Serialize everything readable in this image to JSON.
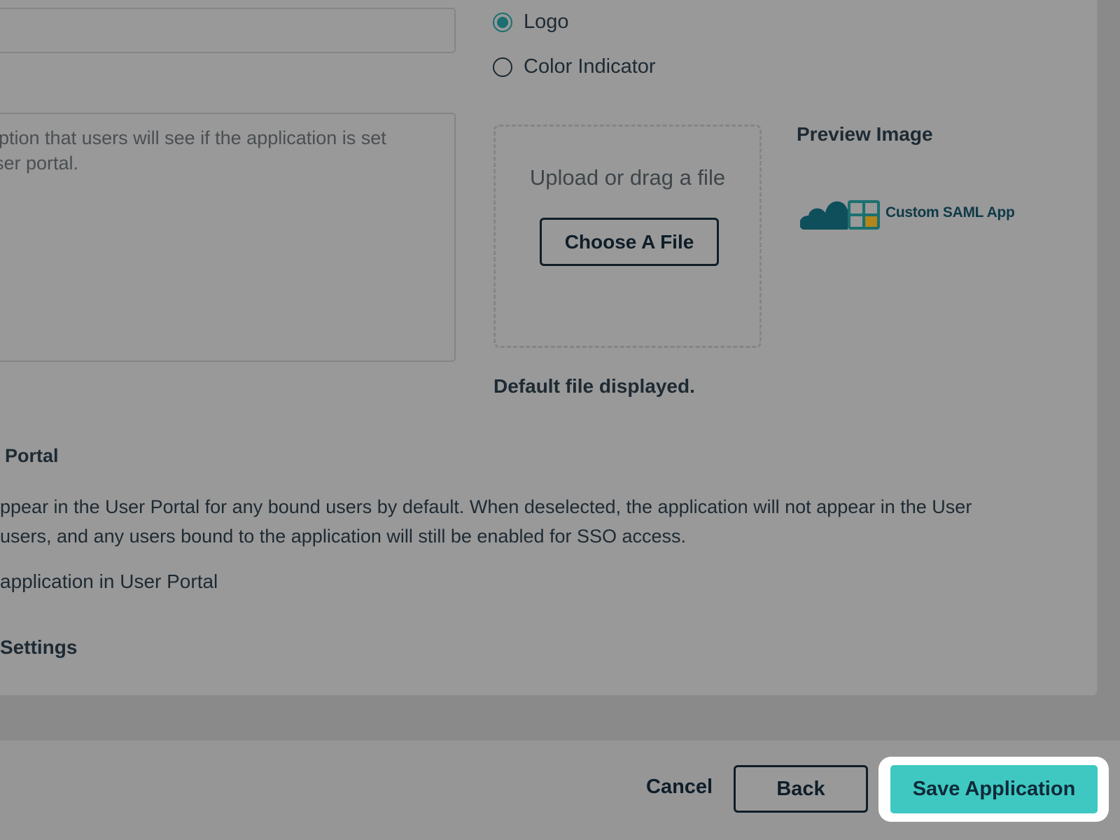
{
  "general_info": {
    "display_name_value": "",
    "description_lines": [
      "iption that users will see if the application is set",
      "ser portal."
    ]
  },
  "display_option": {
    "options": [
      {
        "label": "Logo",
        "checked": true
      },
      {
        "label": "Color Indicator",
        "checked": false
      }
    ]
  },
  "upload": {
    "prompt": "Upload or drag a file",
    "button_label": "Choose A File",
    "status_note": "Default file displayed."
  },
  "preview": {
    "title": "Preview Image",
    "app_name": "Custom SAML App",
    "logo_icon": "cloud-grid-logo-icon"
  },
  "user_portal": {
    "heading": "Portal",
    "description_lines": [
      "ppear in the User Portal for any bound users by default. When deselected, the application will not appear in the User",
      "users, and any users bound to the application will still be enabled for SSO access."
    ],
    "checkbox_label": "application in User Portal"
  },
  "advanced": {
    "heading": "Settings"
  },
  "footer": {
    "cancel_label": "Cancel",
    "back_label": "Back",
    "save_label": "Save Application"
  },
  "colors": {
    "accent": "#3ec8c1",
    "radio_selected": "#1b6f70",
    "overlay": "#999999",
    "highlight": "#ffffff"
  }
}
